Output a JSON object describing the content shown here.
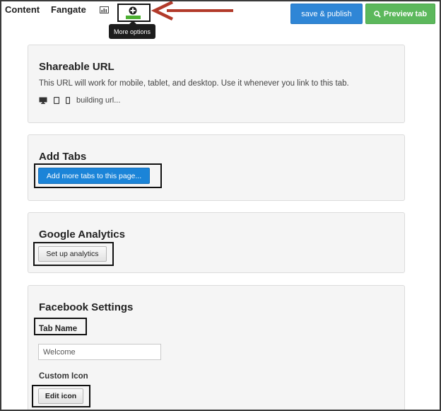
{
  "topnav": {
    "content_label": "Content",
    "fangate_label": "Fangate",
    "chart_icon": "bar-chart-icon",
    "more_icon": "plus-circle-icon",
    "tooltip": "More options",
    "publish_label": "save & publish",
    "preview_label": "Preview tab",
    "preview_icon": "search-icon"
  },
  "shareable": {
    "title": "Shareable URL",
    "description": "This URL will work for mobile, tablet, and desktop. Use it whenever you link to this tab.",
    "devices": [
      "desktop-icon",
      "tablet-icon",
      "phone-icon"
    ],
    "status": "building url..."
  },
  "add_tabs": {
    "title": "Add Tabs",
    "button_label": "Add more tabs to this page..."
  },
  "analytics": {
    "title": "Google Analytics",
    "button_label": "Set up analytics"
  },
  "facebook": {
    "title": "Facebook Settings",
    "tab_name_label": "Tab Name",
    "tab_name_value": "Welcome",
    "custom_icon_label": "Custom Icon",
    "edit_icon_label": "Edit icon"
  },
  "colors": {
    "publish_button": "#2f86d6",
    "preview_button": "#5cb85c",
    "annotation_arrow": "#b23a2a",
    "plus_bar": "#4caf32"
  }
}
